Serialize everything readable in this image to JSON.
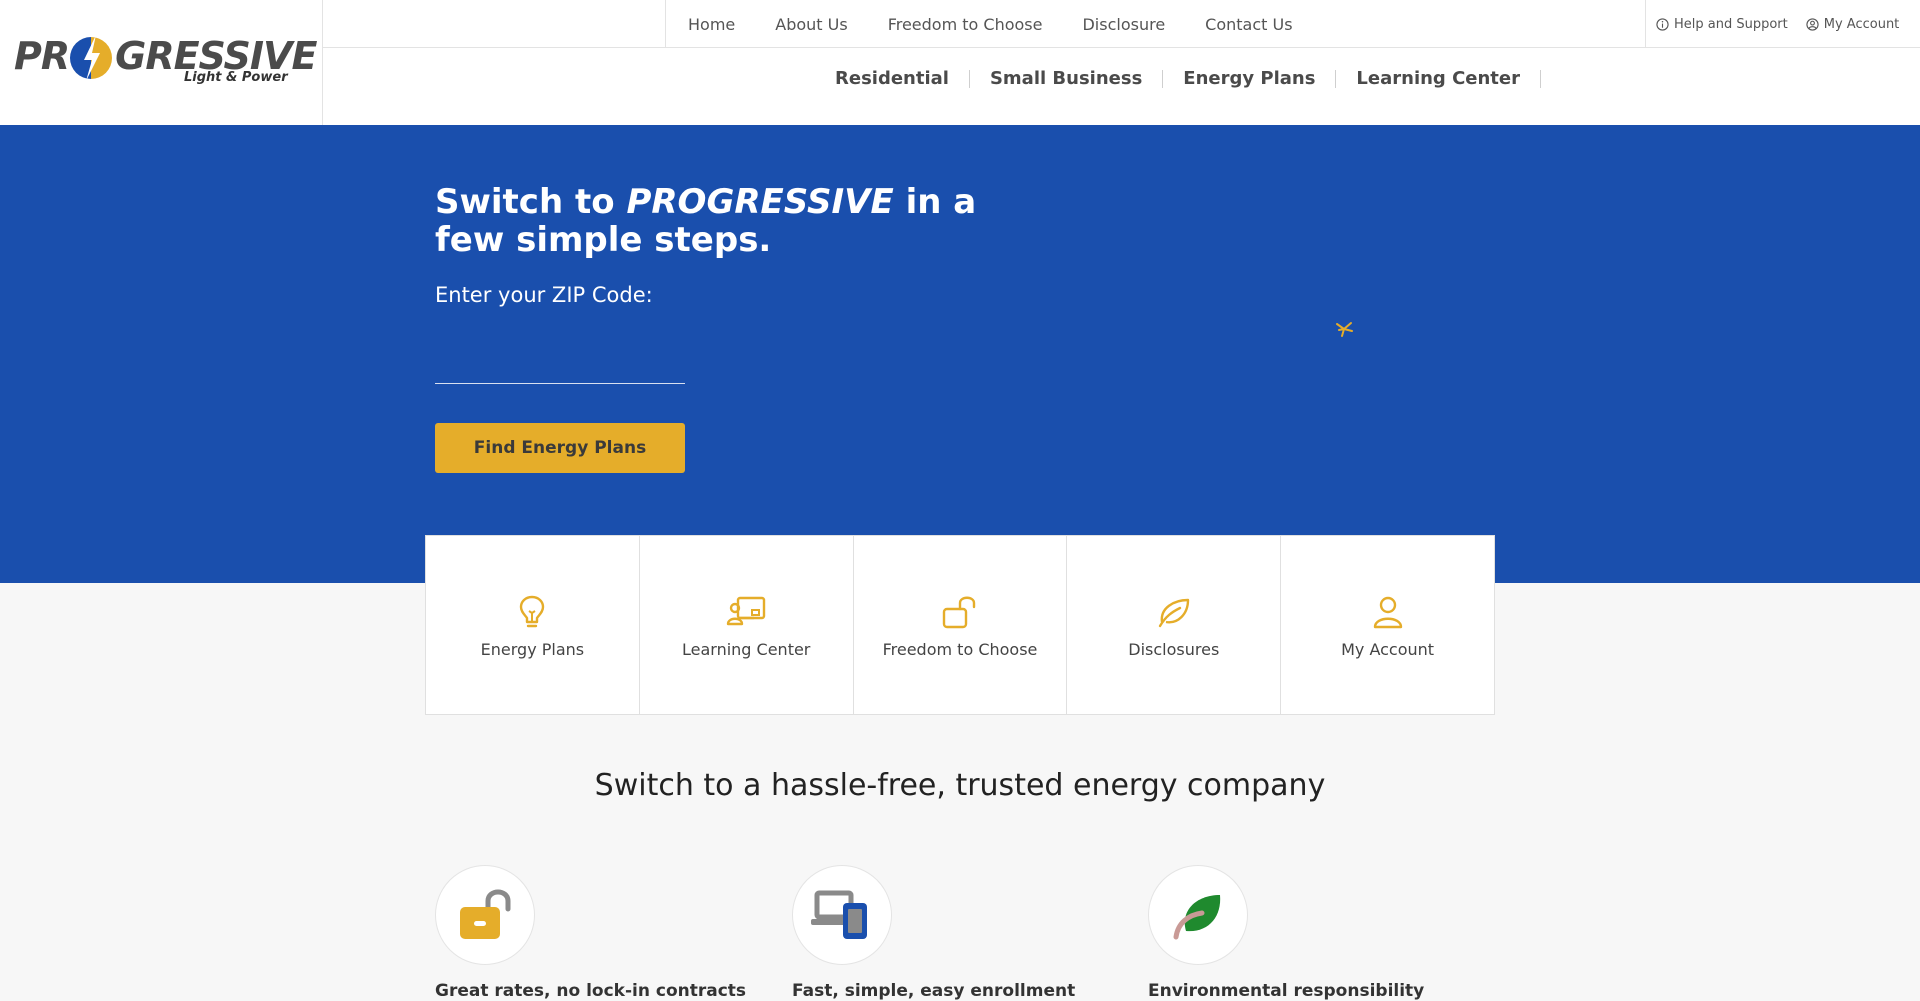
{
  "brand": {
    "name": "PROGRESSIVE",
    "tagline": "Light & Power",
    "accent": "#e5ad2a",
    "primary": "#1a4fad"
  },
  "top_nav": [
    "Home",
    "About Us",
    "Freedom to Choose",
    "Disclosure",
    "Contact Us"
  ],
  "utility": {
    "help": "Help and Support",
    "account": "My Account"
  },
  "main_nav": [
    "Residential",
    "Small Business",
    "Energy Plans",
    "Learning Center"
  ],
  "hero": {
    "title_pre": "Switch to ",
    "title_brand": "PROGRESSIVE",
    "title_post": " in a few simple steps.",
    "zip_label": "Enter your ZIP Code:",
    "zip_value": "",
    "cta": "Find Energy Plans"
  },
  "tiles": [
    {
      "label": "Energy Plans",
      "icon": "lightbulb-icon"
    },
    {
      "label": "Learning Center",
      "icon": "presentation-icon"
    },
    {
      "label": "Freedom to Choose",
      "icon": "unlock-icon"
    },
    {
      "label": "Disclosures",
      "icon": "leaf-icon"
    },
    {
      "label": "My Account",
      "icon": "user-icon"
    }
  ],
  "benefits_title": "Switch to a hassle-free, trusted energy company",
  "benefits": [
    {
      "label": "Great rates, no lock-in contracts",
      "icon": "padlock-icon"
    },
    {
      "label": "Fast, simple, easy enrollment",
      "icon": "devices-icon"
    },
    {
      "label": "Environmental responsibility",
      "icon": "leaf-icon"
    }
  ]
}
